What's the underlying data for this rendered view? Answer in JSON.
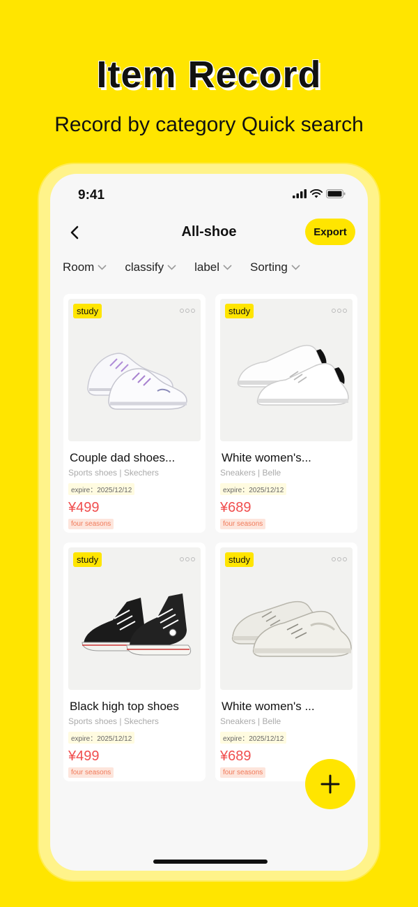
{
  "promo": {
    "title": "Item Record",
    "subtitle": "Record by category Quick search"
  },
  "status_bar": {
    "time": "9:41"
  },
  "header": {
    "title": "All-shoe",
    "export_label": "Export"
  },
  "filters": [
    {
      "label": "Room"
    },
    {
      "label": "classify"
    },
    {
      "label": "label"
    },
    {
      "label": "Sorting"
    }
  ],
  "items": [
    {
      "tag": "study",
      "name": "Couple dad shoes...",
      "brand": "Sports shoes | Skechers",
      "expire": "expire：2025/12/12",
      "price": "¥499",
      "season": "four seasons",
      "image_icon": "chunky-sneaker-image"
    },
    {
      "tag": "study",
      "name": "White women's...",
      "brand": "Sneakers | Belle",
      "expire": "expire：2025/12/12",
      "price": "¥689",
      "season": "four seasons",
      "image_icon": "white-sneaker-image"
    },
    {
      "tag": "study",
      "name": "Black high top shoes",
      "brand": "Sports shoes | Skechers",
      "expire": "expire：2025/12/12",
      "price": "¥499",
      "season": "four seasons",
      "image_icon": "high-top-sneaker-image"
    },
    {
      "tag": "study",
      "name": "White women's ...",
      "brand": "Sneakers | Belle",
      "expire": "expire：2025/12/12",
      "price": "¥689",
      "season": "four seasons",
      "image_icon": "white-chunky-sneaker-image"
    }
  ],
  "colors": {
    "accent": "#FFE500",
    "price": "#F04E4E",
    "season_bg": "#FDE5DC"
  }
}
